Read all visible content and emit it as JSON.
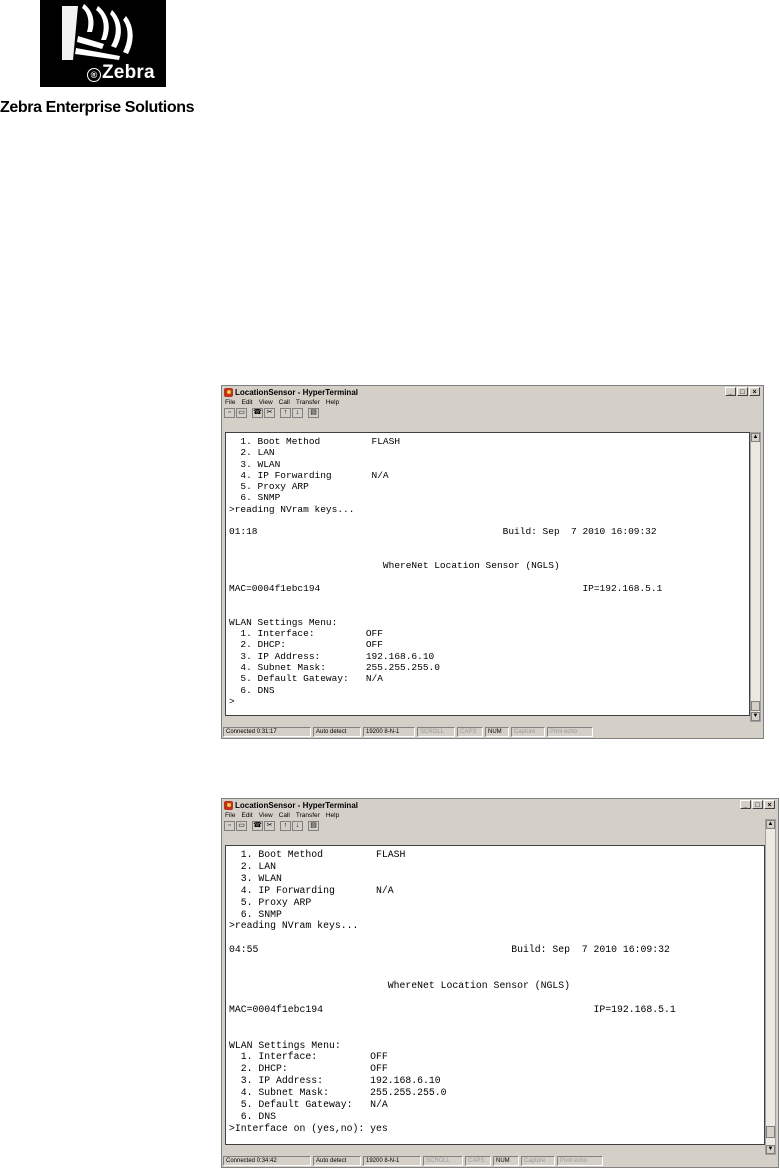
{
  "logo": {
    "wordmark": "Zebra",
    "reg_mark": "®",
    "company": "Zebra Enterprise Solutions"
  },
  "windows": [
    {
      "title": "LocationSensor - HyperTerminal",
      "menu": [
        "File",
        "Edit",
        "View",
        "Call",
        "Transfer",
        "Help"
      ],
      "terminal_text": "  1. Boot Method         FLASH\n  2. LAN\n  3. WLAN\n  4. IP Forwarding       N/A\n  5. Proxy ARP\n  6. SNMP\n>reading NVram keys...\n\n01:18                                           Build: Sep  7 2010 16:09:32\n\n\n                           WhereNet Location Sensor (NGLS)\n\nMAC=0004f1ebc194                                              IP=192.168.5.1\n\n\nWLAN Settings Menu:\n  1. Interface:         OFF\n  2. DHCP:              OFF\n  3. IP Address:        192.168.6.10\n  4. Subnet Mask:       255.255.255.0\n  5. Default Gateway:   N/A\n  6. DNS\n>",
      "status": [
        "Connected 0:31:17",
        "Auto detect",
        "19200 8-N-1",
        "SCROLL",
        "CAPS",
        "NUM",
        "Capture",
        "Print echo"
      ]
    },
    {
      "title": "LocationSensor - HyperTerminal",
      "menu": [
        "File",
        "Edit",
        "View",
        "Call",
        "Transfer",
        "Help"
      ],
      "terminal_text": "  1. Boot Method         FLASH\n  2. LAN\n  3. WLAN\n  4. IP Forwarding       N/A\n  5. Proxy ARP\n  6. SNMP\n>reading NVram keys...\n\n04:55                                           Build: Sep  7 2010 16:09:32\n\n\n                           WhereNet Location Sensor (NGLS)\n\nMAC=0004f1ebc194                                              IP=192.168.5.1\n\n\nWLAN Settings Menu:\n  1. Interface:         OFF\n  2. DHCP:              OFF\n  3. IP Address:        192.168.6.10\n  4. Subnet Mask:       255.255.255.0\n  5. Default Gateway:   N/A\n  6. DNS\n>Interface on (yes,no): yes",
      "status": [
        "Connected 0:34:42",
        "Auto detect",
        "19200 8-N-1",
        "SCROLL",
        "CAPS",
        "NUM",
        "Capture",
        "Print echo"
      ]
    }
  ],
  "icons": {
    "app": "hyperterminal-icon",
    "minimize": "minimize-icon",
    "maximize": "maximize-icon",
    "close": "close-icon"
  }
}
